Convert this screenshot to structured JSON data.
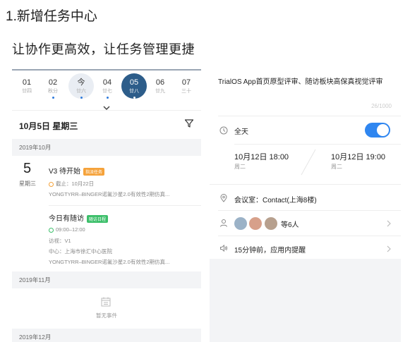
{
  "page_title": "1.新增任务中心",
  "subtitle": "让协作更高效，让任务管理更捷",
  "calendar": {
    "days": [
      {
        "num": "01",
        "sub": "廿四",
        "dot": false
      },
      {
        "num": "02",
        "sub": "秋分",
        "dot": true
      },
      {
        "num": "今",
        "sub": "廿六",
        "dot": true,
        "today": true
      },
      {
        "num": "04",
        "sub": "廿七",
        "dot": true
      },
      {
        "num": "05",
        "sub": "廿八",
        "dot": true,
        "selected": true
      },
      {
        "num": "06",
        "sub": "廿九",
        "dot": false
      },
      {
        "num": "07",
        "sub": "三十",
        "dot": false
      }
    ],
    "date_heading": "10月5日 星期三",
    "months": [
      "2019年10月",
      "2019年11月",
      "2019年12月"
    ],
    "big_day": "5",
    "big_weekday": "星期三",
    "events": [
      {
        "title": "V3 待开始",
        "tag": "指派任务",
        "tag_color": "#f5a23a",
        "status_color": "#f5a23a",
        "line1": "截止：10月22日",
        "line2": "YONGTYRR–BINGER诺氟沙星2.0有效性2期仿真..."
      },
      {
        "title": "今日有随访",
        "tag": "随访日程",
        "tag_color": "#3cbf6a",
        "status_color": "#3cbf6a",
        "line1": "09:00–12:00",
        "line2": "访视：V1",
        "line3": "中心：上海市徐汇中心医院",
        "line4": "YONGTYRR–BINGER诺氟沙星2.0有效性2期仿真..."
      }
    ],
    "empty_text": "暂无事件"
  },
  "detail": {
    "title": "TrialOS App首页原型评审、随访板块高保真视觉评审",
    "count": "26/1000",
    "allday_label": "全天",
    "allday_on": true,
    "start_time": "10月12日 18:00",
    "start_week": "周二",
    "end_time": "10月12日 19:00",
    "end_week": "周二",
    "location": "会议室：Contact(上海8楼)",
    "participants": "等6人",
    "reminder": "15分钟前，应用内提醒"
  },
  "colors": {
    "accent": "#2f86f0",
    "selected_day": "#2d5d8a"
  }
}
